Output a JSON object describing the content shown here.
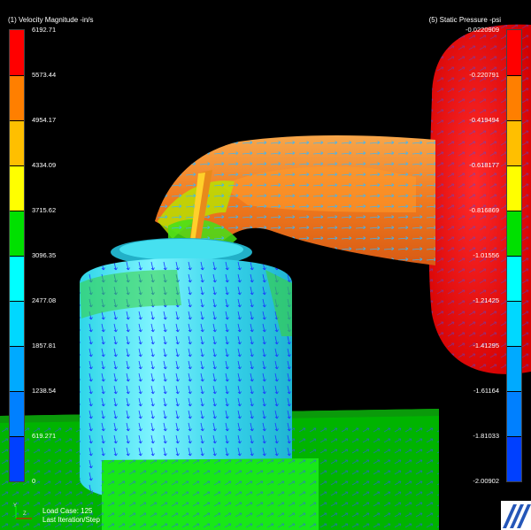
{
  "legend_left": {
    "title": "(1) Velocity Magnitude -in/s",
    "labels": [
      "6192.71",
      "5573.44",
      "4954.17",
      "4334.09",
      "3715.62",
      "3096.35",
      "2477.08",
      "1857.81",
      "1238.54",
      "619.271",
      "0"
    ],
    "colors": [
      "#ff0000",
      "#ff7f00",
      "#ffbf00",
      "#ffff00",
      "#00e000",
      "#00ffff",
      "#00d8ff",
      "#00aaff",
      "#0080ff",
      "#0040ff",
      "#0000ff"
    ]
  },
  "legend_right": {
    "title": "(5) Static Pressure -psi",
    "labels": [
      "-0.0220909",
      "-0.220791",
      "-0.419494",
      "-0.618177",
      "-0.816869",
      "-1.01556",
      "-1.21425",
      "-1.41295",
      "-1.61164",
      "-1.81033",
      "-2.00902"
    ],
    "colors": [
      "#ff0000",
      "#ff7f00",
      "#ffbf00",
      "#ffff00",
      "#00e000",
      "#00ffff",
      "#00d8ff",
      "#00aaff",
      "#0080ff",
      "#0040ff",
      "#0000ff"
    ]
  },
  "status": {
    "line1": "Load Case: 125",
    "line2": "Last Iteration/Step"
  },
  "axis": {
    "y": "Y",
    "z": "Z"
  },
  "icons": [
    "axis-triad-icon",
    "app-logo-icon"
  ]
}
